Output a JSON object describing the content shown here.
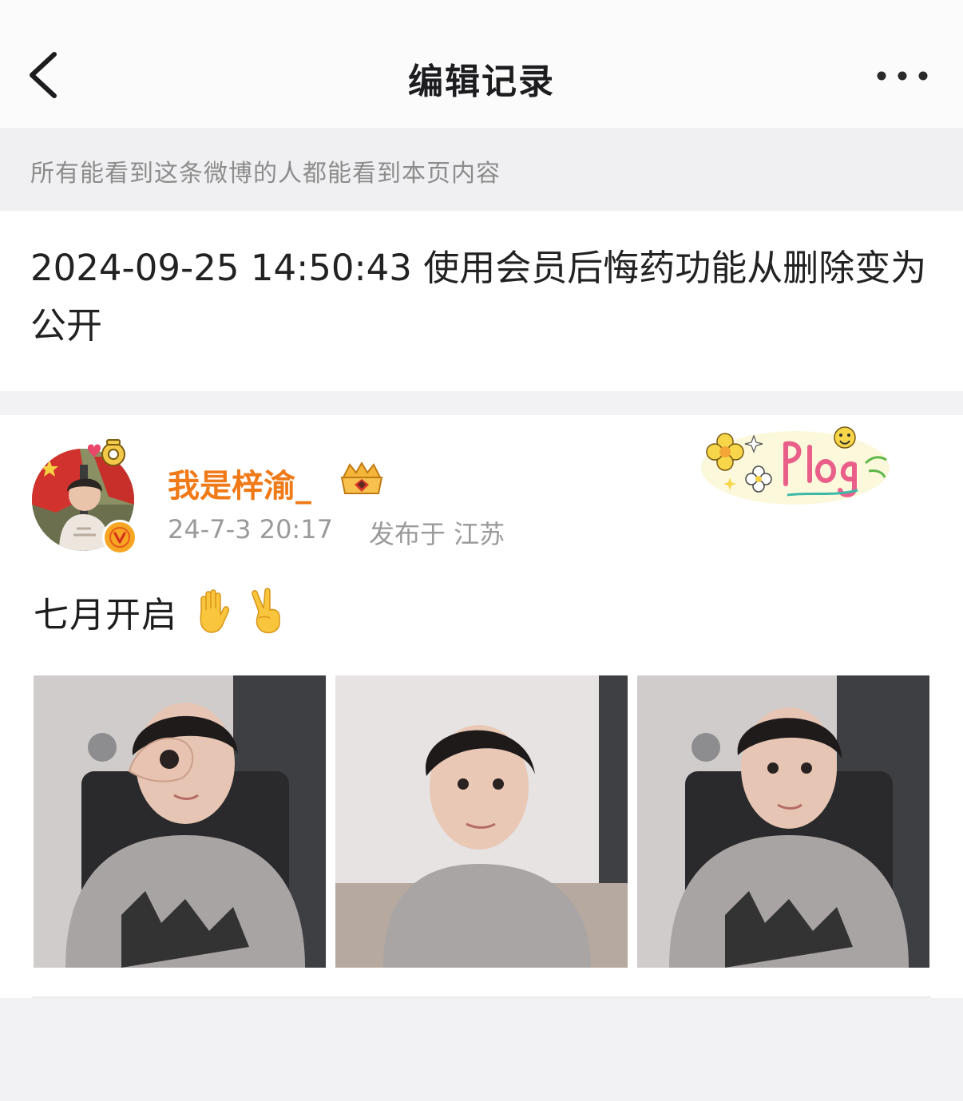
{
  "header": {
    "title": "编辑记录",
    "back_icon": "chevron-left-icon",
    "more_icon": "more-dots-icon"
  },
  "notice": {
    "text": "所有能看到这条微博的人都能看到本页内容"
  },
  "record": {
    "text": "2024-09-25 14:50:43 使用会员后悔药功能从删除变为公开"
  },
  "post": {
    "author": {
      "name": "我是梓渝_",
      "verified": true,
      "vip_icon": "vip-crown-icon",
      "verify_icon": "verified-v-icon"
    },
    "time": "24-7-3 20:17",
    "location": "发布于 江苏",
    "sticker": "plog-sticker",
    "text": "七月开启",
    "emojis": [
      "raised-hand-emoji",
      "victory-hand-emoji"
    ],
    "photo_count": 3
  },
  "colors": {
    "username": "#f07a18",
    "page_bg": "#f2f2f4",
    "notice_text": "#8c8c8c",
    "meta_text": "#9a9a9a",
    "verify_badge": "#f6a623"
  }
}
